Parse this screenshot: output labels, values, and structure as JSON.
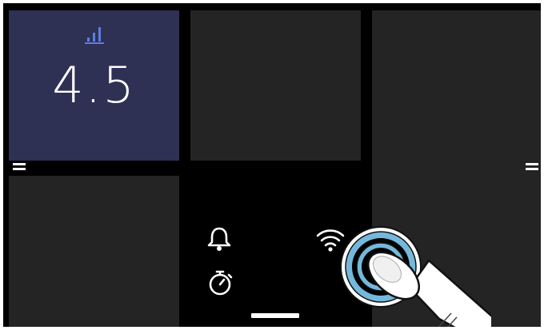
{
  "widget": {
    "value": "4.5",
    "icon": "bar-chart-icon",
    "accent_color": "#5b7fe0",
    "background_color": "#2e3054"
  },
  "quick_settings": {
    "icons": [
      "bell-icon",
      "timer-icon",
      "wifi-icon"
    ]
  },
  "gesture": {
    "type": "tap",
    "target": "wifi-icon",
    "ring_color": "#74b8dc"
  },
  "colors": {
    "screen": "#000000",
    "tile": "#242424",
    "foreground": "#ffffff"
  }
}
